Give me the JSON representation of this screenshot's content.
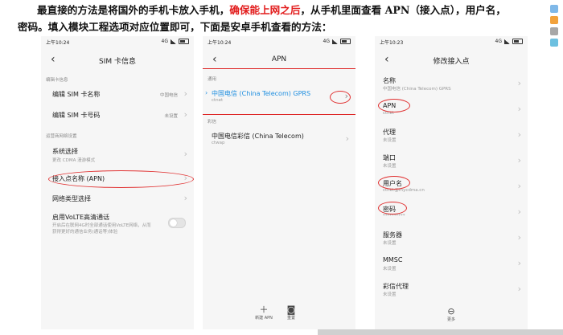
{
  "intro": {
    "part1": "最直接的方法是将国外的手机卡放入手机，",
    "highlight": "确保能上网之后",
    "part2": "，从手机里面查看 APN（接入点），用户名，",
    "line2": "密码。填入模块工程选项对应位置即可，下面是安卓手机查看的方法："
  },
  "screen1": {
    "time": "上午10:24",
    "signal": "4G",
    "title": "SIM 卡信息",
    "group1": "编辑卡信息",
    "rows": [
      {
        "label": "编辑 SIM 卡名称",
        "value": "中国电信"
      },
      {
        "label": "编辑 SIM 卡号码",
        "value": "未设置"
      }
    ],
    "group2": "运营商网络设置",
    "system_label": "系统选择",
    "system_sub": "更改 CDMA 漫游模式",
    "apn_label": "接入点名称 (APN)",
    "nettype_label": "网络类型选择",
    "volte_label": "启用VoLTE高清通话",
    "volte_sub1": "开启后在联网4G时全部通话使用VoLTE网络，从而",
    "volte_sub2": "获得更好的通信业务(通话等)体验"
  },
  "screen2": {
    "time": "上午10:24",
    "signal": "4G",
    "title": "APN",
    "group1": "通用",
    "apn1_name": "中国电信 (China Telecom) GPRS",
    "apn1_sub": "ctnet",
    "group2": "彩信",
    "apn2_name": "中国电信彩信 (China Telecom)",
    "apn2_sub": "ctwap",
    "new_apn": "新建 APN",
    "reset": "重置"
  },
  "screen3": {
    "time": "上午10:23",
    "signal": "4G",
    "title": "修改接入点",
    "fields": [
      {
        "label": "名称",
        "value": "中国电信 (China Telecom) GPRS"
      },
      {
        "label": "APN",
        "value": "ctnet"
      },
      {
        "label": "代理",
        "value": "未设置"
      },
      {
        "label": "端口",
        "value": "未设置"
      },
      {
        "label": "用户名",
        "value": "ctnet@mycdma.cn"
      },
      {
        "label": "密码",
        "value": "**********"
      },
      {
        "label": "服务器",
        "value": "未设置"
      },
      {
        "label": "MMSC",
        "value": "未设置"
      },
      {
        "label": "彩信代理",
        "value": "未设置"
      }
    ],
    "more": "更多"
  },
  "colors": {
    "accent": "#1f8fe0",
    "annotation": "#e03030",
    "highlight_text": "#e21c1c"
  }
}
